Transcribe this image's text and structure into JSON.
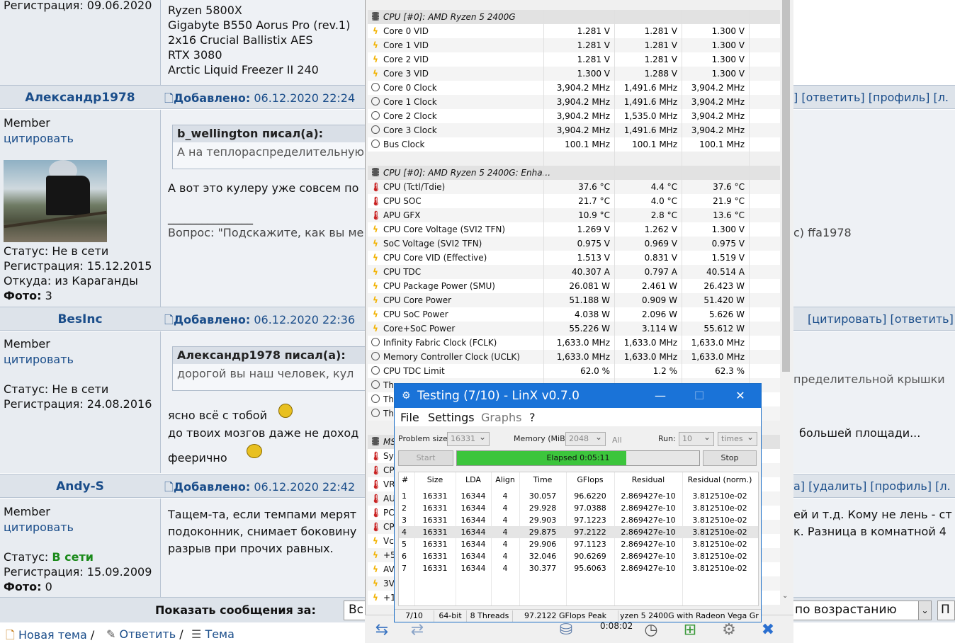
{
  "forum": {
    "post0": {
      "reg": "Регистрация: 09.06.2020",
      "specs": [
        "Ryzen 5800X",
        "Gigabyte B550 Aorus Pro (rev.1)",
        "2x16 Crucial Ballistix AES",
        "RTX 3080",
        "Arctic Liquid Freezer II 240"
      ]
    },
    "post1": {
      "user": "Александр1978",
      "added_label": "Добавлено:",
      "date": "06.12.2020 22:24",
      "links": "] [ответить] [профиль] [л.",
      "rank": "Member",
      "quote_link": "цитировать",
      "status_label": "Статус:",
      "status": "Не в сети",
      "reg": "Регистрация: 15.12.2015",
      "from": "Откуда: из Караганды",
      "photo_label": "Фото:",
      "photo": "3",
      "quote_head": "b_wellington писал(а):",
      "quote_body": "А на теплораспределительную",
      "text": "А вот это кулеру уже совсем по",
      "sig_line": "_______________",
      "sig": "Вопрос: \"Подскажите, как вы ме",
      "sig_tail": "c) ffa1978"
    },
    "post2": {
      "user": "BesInc",
      "added_label": "Добавлено:",
      "date": "06.12.2020 22:36",
      "links": "[цитировать] [ответить]",
      "rank": "Member",
      "quote_link": "цитировать",
      "status_label": "Статус:",
      "status": "Не в сети",
      "reg": "Регистрация: 24.08.2016",
      "quote_head": "Александр1978 писал(а):",
      "quote_body": "дорогой вы наш человек, кул",
      "quote_tail": "пределительной крышки",
      "line1": "ясно всё с тобой",
      "line2": "до твоих мозгов даже не доход",
      "line2_tail": "большей площади...",
      "line3": "феерично"
    },
    "post3": {
      "user": "Andy-S",
      "added_label": "Добавлено:",
      "date": "06.12.2020 22:42",
      "links": "а] [удалить] [профиль] [л.",
      "rank": "Member",
      "quote_link": "цитировать",
      "status_label": "Статус:",
      "status": "В сети",
      "reg": "Регистрация: 15.09.2009",
      "photo_label": "Фото:",
      "photo": "0",
      "line1": "Тащем-та, если темпами мерят",
      "line1_tail": "ей и т.д. Кому не лень - ст",
      "line2": "подоконник, снимает боковину",
      "line2_tail": "к. Разница в комнатной 4",
      "line3": "разрыв при прочих равных."
    },
    "footer": {
      "show_label": "Показать сообщения за:",
      "show_value": "Вс",
      "order_value": "по возрастанию",
      "next_value": "П",
      "new_topic": "Новая тема",
      "reply": "Ответить",
      "topic": "Тема"
    }
  },
  "hwinfo": {
    "groups": [
      {
        "title": "CPU [#0]: AMD Ryzen 5 2400G"
      },
      {
        "title": "CPU [#0]: AMD Ryzen 5 2400G: Enha..."
      },
      {
        "title": "MS"
      }
    ],
    "rows1": [
      {
        "icon": "bolt",
        "name": "Core 0 VID",
        "cur": "1.281 V",
        "min": "1.281 V",
        "max": "1.300 V"
      },
      {
        "icon": "bolt",
        "name": "Core 1 VID",
        "cur": "1.281 V",
        "min": "1.281 V",
        "max": "1.300 V"
      },
      {
        "icon": "bolt",
        "name": "Core 2 VID",
        "cur": "1.281 V",
        "min": "1.281 V",
        "max": "1.300 V"
      },
      {
        "icon": "bolt",
        "name": "Core 3 VID",
        "cur": "1.300 V",
        "min": "1.288 V",
        "max": "1.300 V"
      },
      {
        "icon": "clock",
        "name": "Core 0 Clock",
        "cur": "3,904.2 MHz",
        "min": "1,491.6 MHz",
        "max": "3,904.2 MHz"
      },
      {
        "icon": "clock",
        "name": "Core 1 Clock",
        "cur": "3,904.2 MHz",
        "min": "1,491.6 MHz",
        "max": "3,904.2 MHz"
      },
      {
        "icon": "clock",
        "name": "Core 2 Clock",
        "cur": "3,904.2 MHz",
        "min": "1,535.0 MHz",
        "max": "3,904.2 MHz"
      },
      {
        "icon": "clock",
        "name": "Core 3 Clock",
        "cur": "3,904.2 MHz",
        "min": "1,491.6 MHz",
        "max": "3,904.2 MHz"
      },
      {
        "icon": "clock",
        "name": "Bus Clock",
        "cur": "100.1 MHz",
        "min": "100.1 MHz",
        "max": "100.1 MHz"
      }
    ],
    "rows2": [
      {
        "icon": "therm",
        "name": "CPU (Tctl/Tdie)",
        "cur": "37.6 °C",
        "min": "4.4 °C",
        "max": "37.6 °C"
      },
      {
        "icon": "therm",
        "name": "CPU SOC",
        "cur": "21.7 °C",
        "min": "4.0 °C",
        "max": "21.9 °C"
      },
      {
        "icon": "therm",
        "name": "APU GFX",
        "cur": "10.9 °C",
        "min": "2.8 °C",
        "max": "13.6 °C"
      },
      {
        "icon": "bolt",
        "name": "CPU Core Voltage (SVI2 TFN)",
        "cur": "1.269 V",
        "min": "1.262 V",
        "max": "1.300 V"
      },
      {
        "icon": "bolt",
        "name": "SoC Voltage (SVI2 TFN)",
        "cur": "0.975 V",
        "min": "0.969 V",
        "max": "0.975 V"
      },
      {
        "icon": "bolt",
        "name": "CPU Core VID (Effective)",
        "cur": "1.513 V",
        "min": "0.831 V",
        "max": "1.519 V"
      },
      {
        "icon": "bolt",
        "name": "CPU TDC",
        "cur": "40.307 A",
        "min": "0.797 A",
        "max": "40.514 A"
      },
      {
        "icon": "bolt",
        "name": "CPU Package Power (SMU)",
        "cur": "26.081 W",
        "min": "2.461 W",
        "max": "26.423 W"
      },
      {
        "icon": "bolt",
        "name": "CPU Core Power",
        "cur": "51.188 W",
        "min": "0.909 W",
        "max": "51.420 W"
      },
      {
        "icon": "bolt",
        "name": "CPU SoC Power",
        "cur": "4.038 W",
        "min": "2.096 W",
        "max": "5.626 W"
      },
      {
        "icon": "bolt",
        "name": "Core+SoC Power",
        "cur": "55.226 W",
        "min": "3.114 W",
        "max": "55.612 W"
      },
      {
        "icon": "clock",
        "name": "Infinity Fabric Clock (FCLK)",
        "cur": "1,633.0 MHz",
        "min": "1,633.0 MHz",
        "max": "1,633.0 MHz"
      },
      {
        "icon": "clock",
        "name": "Memory Controller Clock (UCLK)",
        "cur": "1,633.0 MHz",
        "min": "1,633.0 MHz",
        "max": "1,633.0 MHz"
      },
      {
        "icon": "clock",
        "name": "CPU TDC Limit",
        "cur": "62.0 %",
        "min": "1.2 %",
        "max": "62.3 %"
      },
      {
        "icon": "clock",
        "name": "Th",
        "cur": "",
        "min": "",
        "max": ""
      },
      {
        "icon": "clock",
        "name": "Th",
        "cur": "",
        "min": "",
        "max": ""
      },
      {
        "icon": "clock",
        "name": "Th",
        "cur": "",
        "min": "",
        "max": ""
      }
    ],
    "rows3": [
      {
        "icon": "therm",
        "name": "Sys"
      },
      {
        "icon": "therm",
        "name": "CP"
      },
      {
        "icon": "therm",
        "name": "VR"
      },
      {
        "icon": "therm",
        "name": "AU"
      },
      {
        "icon": "therm",
        "name": "PC"
      },
      {
        "icon": "therm",
        "name": "CP"
      },
      {
        "icon": "bolt",
        "name": "Vc"
      },
      {
        "icon": "bolt",
        "name": "+5"
      },
      {
        "icon": "bolt",
        "name": "AV"
      },
      {
        "icon": "bolt",
        "name": "3V"
      },
      {
        "icon": "bolt",
        "name": "+1"
      }
    ],
    "timer": "0:08:02"
  },
  "linx": {
    "title": "Testing (7/10) - LinX v0.7.0",
    "menu": [
      "File",
      "Settings",
      "Graphs",
      "?"
    ],
    "problem_label": "Problem size:",
    "problem_value": "16331",
    "memory_label": "Memory (MiB):",
    "memory_value": "2048",
    "all_label": "All",
    "run_label": "Run:",
    "run_value": "10",
    "times_value": "times",
    "start_label": "Start",
    "stop_label": "Stop",
    "elapsed": "Elapsed 0:05:11",
    "progress": 0.7,
    "columns": [
      "#",
      "Size",
      "LDA",
      "Align",
      "Time",
      "GFlops",
      "Residual",
      "Residual (norm.)"
    ],
    "rows": [
      [
        "1",
        "16331",
        "16344",
        "4",
        "30.057",
        "96.6220",
        "2.869427e-10",
        "3.812510e-02"
      ],
      [
        "2",
        "16331",
        "16344",
        "4",
        "29.928",
        "97.0388",
        "2.869427e-10",
        "3.812510e-02"
      ],
      [
        "3",
        "16331",
        "16344",
        "4",
        "29.903",
        "97.1223",
        "2.869427e-10",
        "3.812510e-02"
      ],
      [
        "4",
        "16331",
        "16344",
        "4",
        "29.875",
        "97.2122",
        "2.869427e-10",
        "3.812510e-02"
      ],
      [
        "5",
        "16331",
        "16344",
        "4",
        "29.906",
        "97.1123",
        "2.869427e-10",
        "3.812510e-02"
      ],
      [
        "6",
        "16331",
        "16344",
        "4",
        "32.046",
        "90.6269",
        "2.869427e-10",
        "3.812510e-02"
      ],
      [
        "7",
        "16331",
        "16344",
        "4",
        "30.377",
        "95.6063",
        "2.869427e-10",
        "3.812510e-02"
      ]
    ],
    "selected_row": 3,
    "status": [
      "7/10",
      "64-bit",
      "8 Threads",
      "97.2122 GFlops Peak",
      "yzen 5 2400G with Radeon Vega Gr"
    ]
  }
}
